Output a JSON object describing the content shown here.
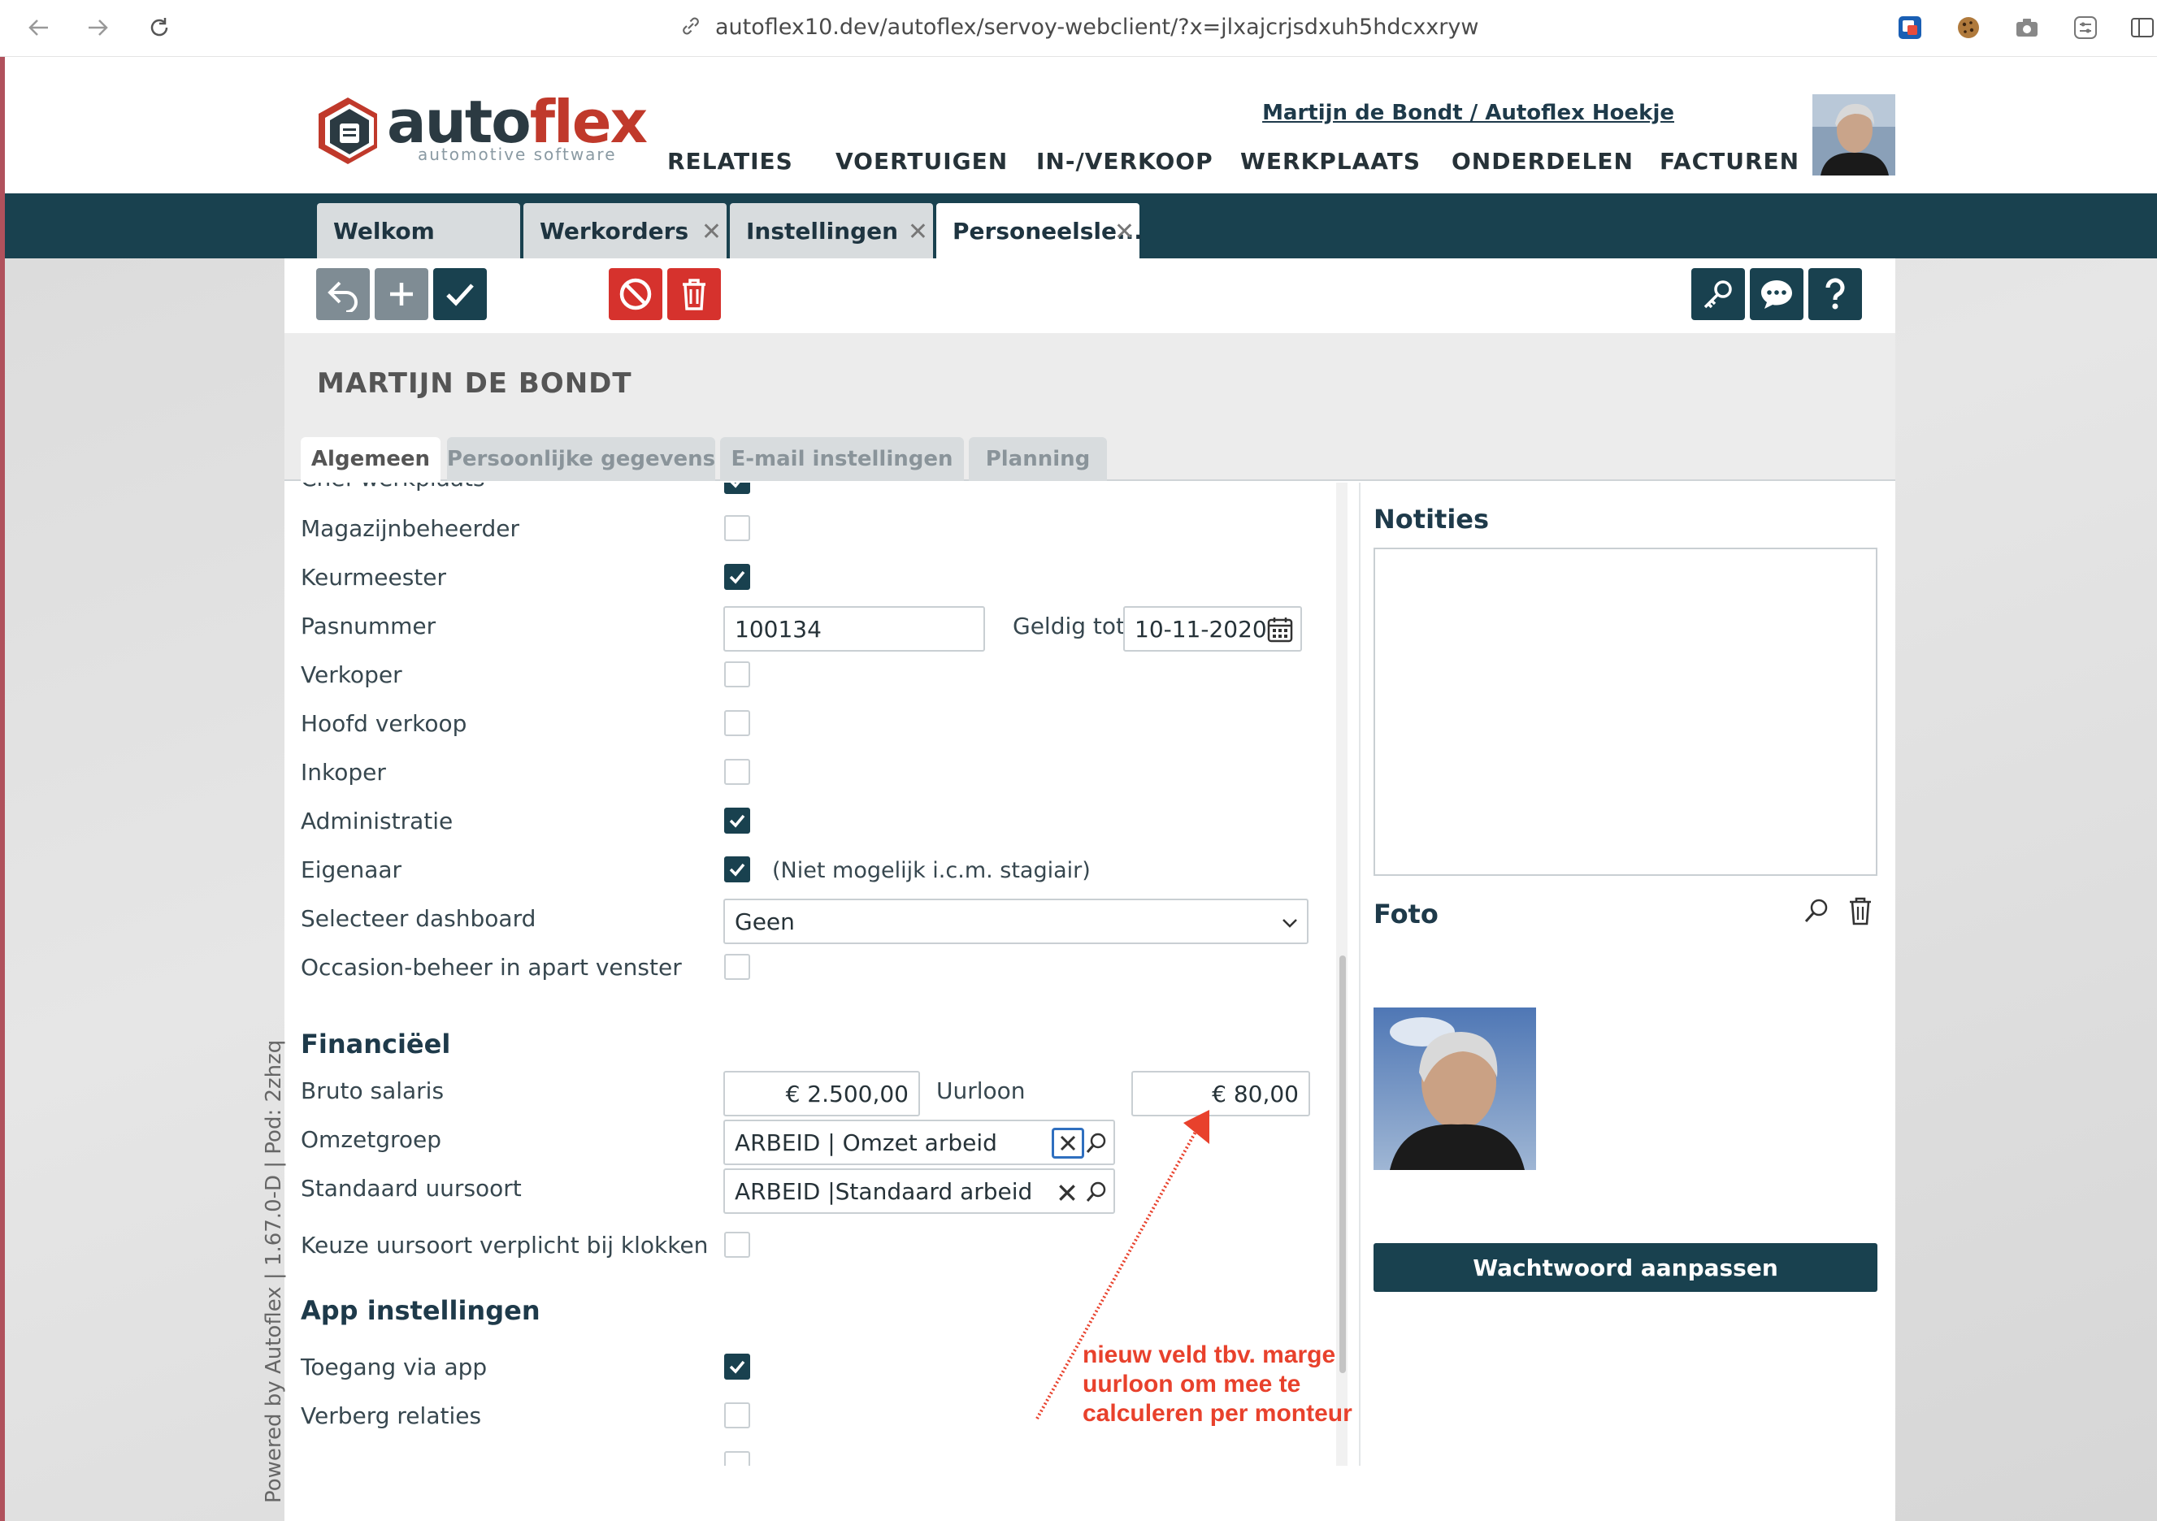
{
  "browser": {
    "url": "autoflex10.dev/autoflex/servoy-webclient/?x=jlxajcrjsdxuh5hdcxxryw"
  },
  "header": {
    "logo_word_a": "auto",
    "logo_word_b": "flex",
    "logo_sub": "automotive software",
    "user_link": "Martijn de Bondt / Autoflex Hoekje",
    "nav": [
      "RELATIES",
      "VOERTUIGEN",
      "IN-/VERKOOP",
      "WERKPLAATS",
      "ONDERDELEN",
      "FACTUREN"
    ]
  },
  "tabs": [
    {
      "label": "Welkom",
      "closable": false
    },
    {
      "label": "Werkorders",
      "closable": true
    },
    {
      "label": "Instellingen",
      "closable": true
    },
    {
      "label": "Personeelsle...",
      "closable": true,
      "active": true
    }
  ],
  "page": {
    "title": "MARTIJN DE BONDT",
    "form_tabs": [
      "Algemeen",
      "Persoonlijke gegevens",
      "E-mail instellingen",
      "Planning"
    ],
    "active_form_tab": "Algemeen"
  },
  "form": {
    "rows": [
      {
        "label": "Chef werkplaats",
        "checked": true
      },
      {
        "label": "Magazijnbeheerder",
        "checked": false
      },
      {
        "label": "Keurmeester",
        "checked": true
      },
      {
        "label": "Verkoper",
        "checked": false
      },
      {
        "label": "Hoofd verkoop",
        "checked": false
      },
      {
        "label": "Inkoper",
        "checked": false
      },
      {
        "label": "Administratie",
        "checked": true
      },
      {
        "label": "Eigenaar",
        "checked": true
      },
      {
        "label": "Occasion-beheer in apart venster",
        "checked": false
      }
    ],
    "pasnummer_label": "Pasnummer",
    "pasnummer_value": "100134",
    "geldig_tot_label": "Geldig tot",
    "geldig_tot_value": "10-11-2020",
    "eigenaar_note": "(Niet mogelijk i.c.m. stagiair)",
    "dashboard_label": "Selecteer dashboard",
    "dashboard_value": "Geen",
    "fin_section": "Financiëel",
    "bruto_label": "Bruto salaris",
    "bruto_value": "€ 2.500,00",
    "uurloon_label": "Uurloon",
    "uurloon_value": "€ 80,00",
    "omzetgroep_label": "Omzetgroep",
    "omzetgroep_value": "ARBEID | Omzet arbeid",
    "uursoort_label": "Standaard uursoort",
    "uursoort_value": "ARBEID |Standaard arbeid",
    "keuze_label": "Keuze uursoort verplicht bij klokken",
    "keuze_checked": false,
    "app_section": "App instellingen",
    "toegang_label": "Toegang via app",
    "toegang_checked": true,
    "verberg_label": "Verberg relaties",
    "verberg_checked": false
  },
  "side": {
    "notities_title": "Notities",
    "foto_title": "Foto",
    "password_button": "Wachtwoord aanpassen"
  },
  "powered_by": "Powered by Autoflex | 1.67.0-D | Pod: 2zhzq",
  "annotation": {
    "lines": [
      "nieuw veld tbv. marge",
      "uurloon om mee te",
      "calculeren per monteur"
    ],
    "color": "#e8412c"
  },
  "colors": {
    "brand_dark": "#19414f",
    "danger": "#d6322d",
    "neutral_button": "#7f8c94"
  }
}
